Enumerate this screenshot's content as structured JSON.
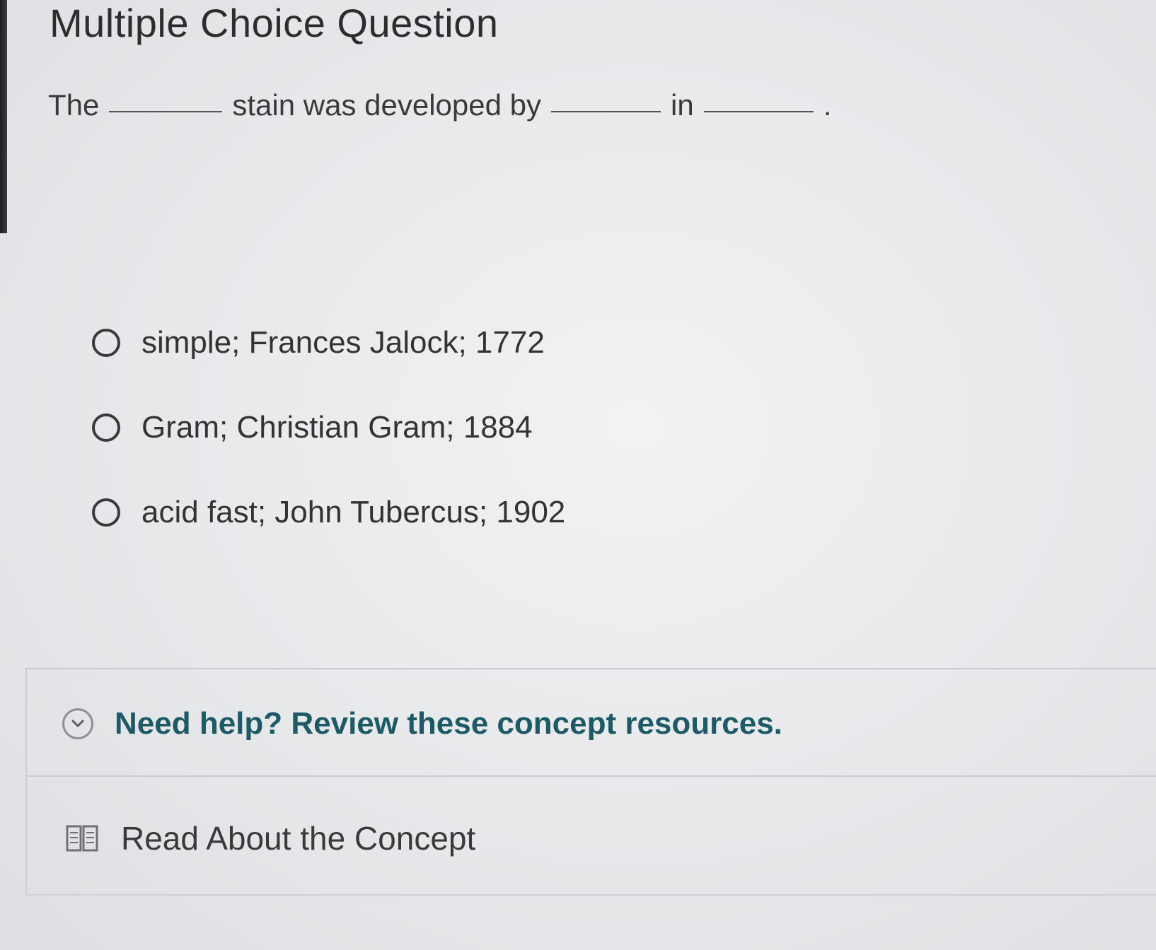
{
  "page_title": "Multiple Choice Question",
  "question": {
    "prefix": "The",
    "segment_1": "stain was developed by",
    "segment_2": "in",
    "suffix": "."
  },
  "options": [
    {
      "label": "simple; Frances Jalock; 1772",
      "selected": false
    },
    {
      "label": "Gram; Christian Gram; 1884",
      "selected": false
    },
    {
      "label": "acid fast; John Tubercus; 1902",
      "selected": false
    }
  ],
  "help": {
    "title": "Need help? Review these concept resources.",
    "resources": [
      {
        "label": "Read About the Concept",
        "icon": "book-icon"
      }
    ],
    "accent_color": "#1e5a66"
  }
}
